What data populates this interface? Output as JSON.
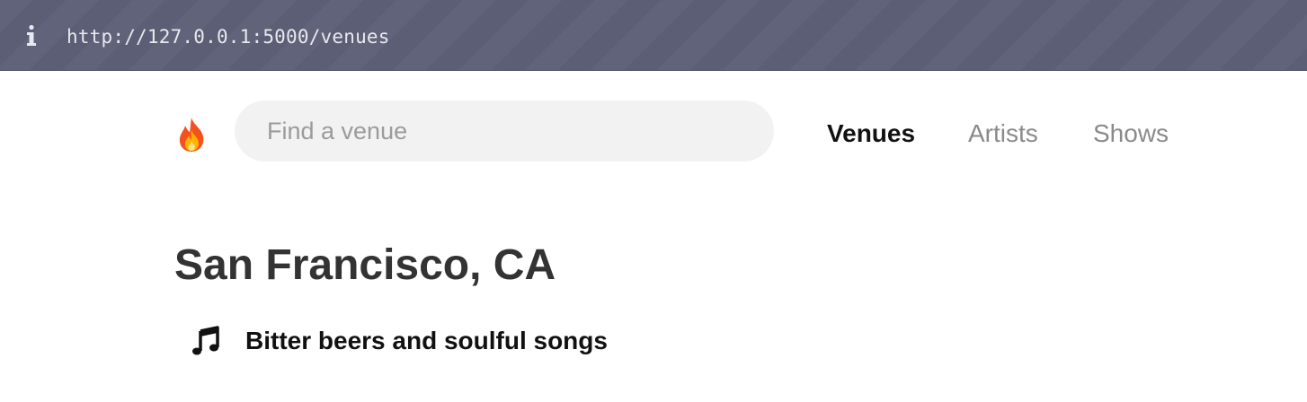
{
  "browser": {
    "url": "http://127.0.0.1:5000/venues",
    "info_icon": "info-icon"
  },
  "header": {
    "logo_icon": "fire-icon",
    "search": {
      "placeholder": "Find a venue",
      "value": ""
    },
    "nav": [
      {
        "label": "Venues",
        "active": true
      },
      {
        "label": "Artists",
        "active": false
      },
      {
        "label": "Shows",
        "active": false
      }
    ]
  },
  "main": {
    "city": "San Francisco, CA",
    "venues": [
      {
        "icon": "music-note-icon",
        "name": "Bitter beers and soulful songs"
      }
    ]
  },
  "colors": {
    "urlbar_bg": "#60637a",
    "search_bg": "#f2f2f2",
    "heading": "#333333",
    "nav_inactive": "#8a8a8a",
    "nav_active": "#111111"
  }
}
